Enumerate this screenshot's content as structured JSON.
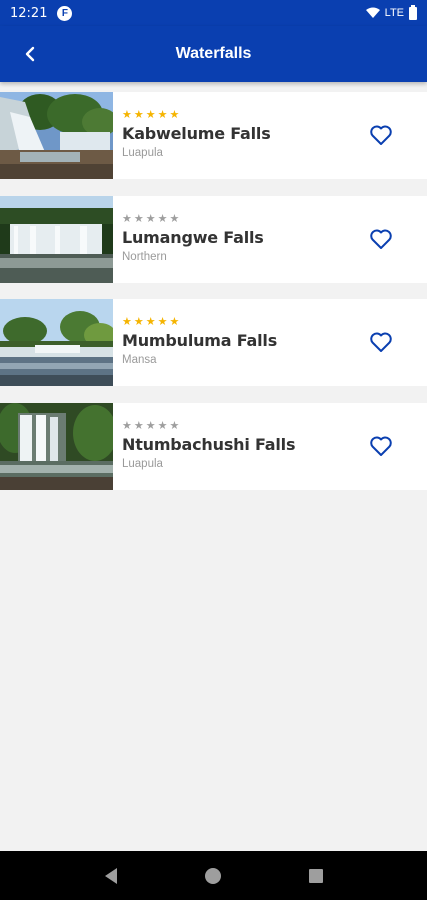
{
  "status_bar": {
    "time": "12:21",
    "app_icon_letter": "F",
    "network": "LTE"
  },
  "app_bar": {
    "title": "Waterfalls",
    "back_icon": "chevron-left-icon"
  },
  "colors": {
    "primary": "#0a3fb0",
    "star_active": "#f5b400",
    "star_inactive": "#9e9e9e",
    "heart": "#0a3fb0"
  },
  "waterfalls": [
    {
      "name": "Kabwelume Falls",
      "location": "Luapula",
      "stars": 5,
      "rated": true
    },
    {
      "name": "Lumangwe Falls",
      "location": "Northern",
      "stars": 5,
      "rated": false
    },
    {
      "name": "Mumbuluma Falls",
      "location": "Mansa",
      "stars": 5,
      "rated": true
    },
    {
      "name": "Ntumbachushi Falls",
      "location": "Luapula",
      "stars": 5,
      "rated": false
    }
  ],
  "nav_bar": {
    "icons": [
      "back-triangle-icon",
      "home-circle-icon",
      "recents-square-icon"
    ]
  }
}
